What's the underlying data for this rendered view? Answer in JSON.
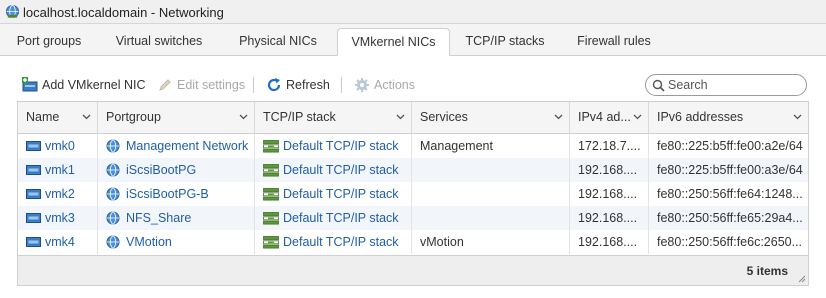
{
  "window": {
    "title": "localhost.localdomain - Networking"
  },
  "tabs": [
    {
      "label": "Port groups",
      "active": false
    },
    {
      "label": "Virtual switches",
      "active": false
    },
    {
      "label": "Physical NICs",
      "active": false
    },
    {
      "label": "VMkernel NICs",
      "active": true
    },
    {
      "label": "TCP/IP stacks",
      "active": false
    },
    {
      "label": "Firewall rules",
      "active": false
    }
  ],
  "toolbar": {
    "add_label": "Add VMkernel NIC",
    "edit_label": "Edit settings",
    "refresh_label": "Refresh",
    "actions_label": "Actions",
    "edit_enabled": false,
    "actions_enabled": false
  },
  "search": {
    "placeholder": "Search",
    "value": ""
  },
  "table": {
    "columns": [
      "Name",
      "Portgroup",
      "TCP/IP stack",
      "Services",
      "IPv4 ad...",
      "IPv6 addresses"
    ],
    "rows": [
      {
        "name": "vmk0",
        "portgroup": "Management Network",
        "stack": "Default TCP/IP stack",
        "services": "Management",
        "ipv4": "172.18.7....",
        "ipv6": "fe80::225:b5ff:fe00:a2e/64"
      },
      {
        "name": "vmk1",
        "portgroup": "iScsiBootPG",
        "stack": "Default TCP/IP stack",
        "services": "",
        "ipv4": "192.168....",
        "ipv6": "fe80::225:b5ff:fe00:a3e/64"
      },
      {
        "name": "vmk2",
        "portgroup": "iScsiBootPG-B",
        "stack": "Default TCP/IP stack",
        "services": "",
        "ipv4": "192.168....",
        "ipv6": "fe80::250:56ff:fe64:1248..."
      },
      {
        "name": "vmk3",
        "portgroup": "NFS_Share",
        "stack": "Default TCP/IP stack",
        "services": "",
        "ipv4": "192.168....",
        "ipv6": "fe80::250:56ff:fe65:29a4..."
      },
      {
        "name": "vmk4",
        "portgroup": "VMotion",
        "stack": "Default TCP/IP stack",
        "services": "vMotion",
        "ipv4": "192.168....",
        "ipv6": "fe80::250:56ff:fe6c:2650..."
      }
    ],
    "footer_count": "5 items"
  },
  "colors": {
    "link": "#1f5ea8",
    "accent": "#0072c6",
    "row_alt": "#f2f6fb"
  },
  "icons": {
    "window": "globe-icon",
    "add": "add-nic-icon",
    "edit": "pencil-icon",
    "refresh": "refresh-icon",
    "actions": "gear-icon",
    "search": "search-icon",
    "nic": "nic-icon",
    "portgroup": "globe-icon",
    "stack": "tcpip-stack-icon"
  }
}
